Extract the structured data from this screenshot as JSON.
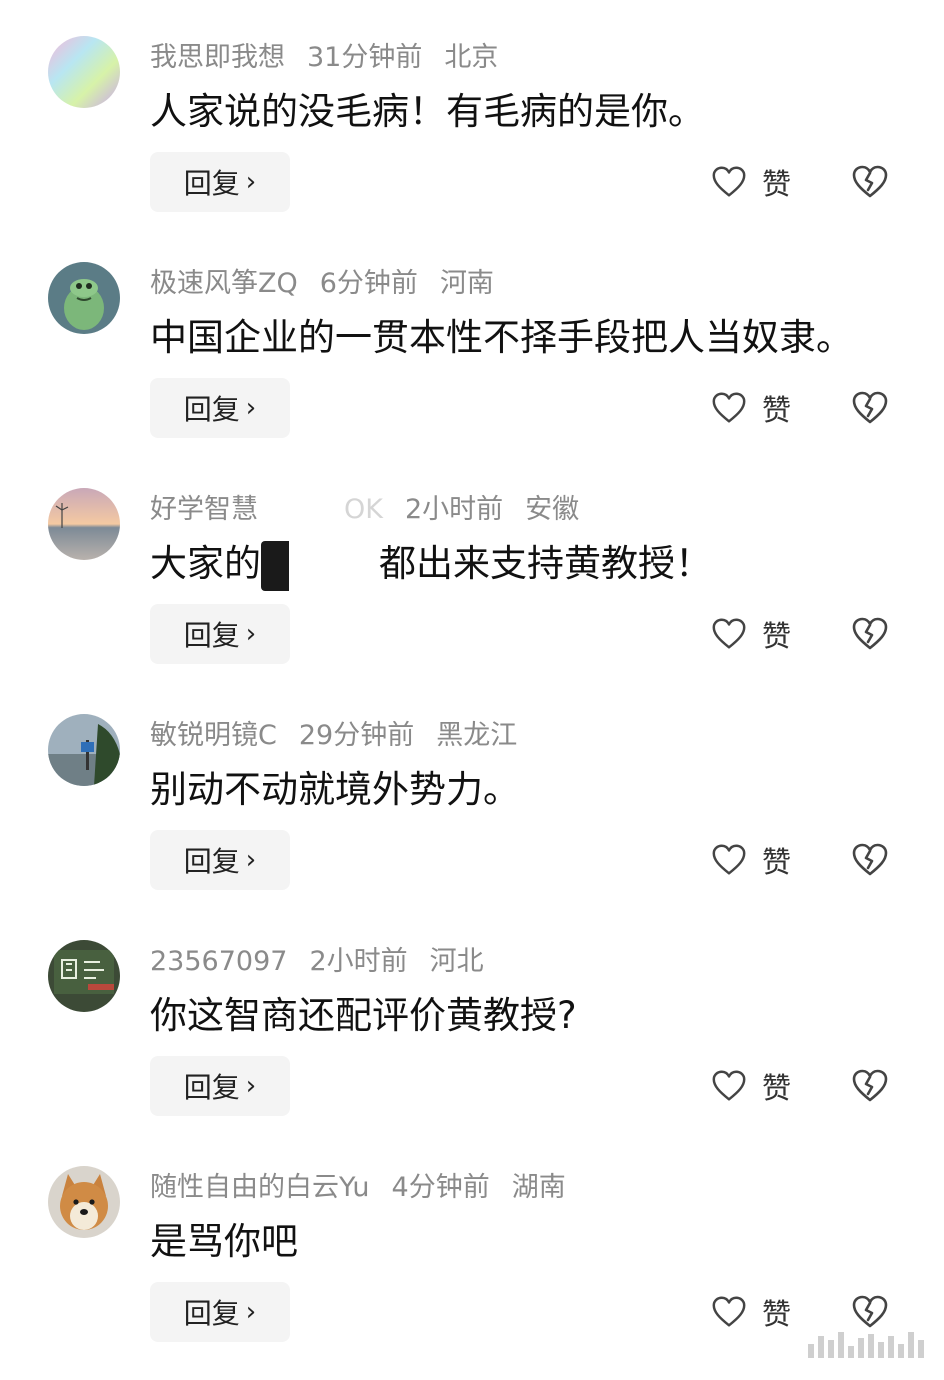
{
  "comments": [
    {
      "username": "我思即我想",
      "time": "31分钟前",
      "location": "北京",
      "text": "人家说的没毛病！有毛病的是你。",
      "reply_label": "回复",
      "like_label": "赞",
      "avatar": "gradient-avatar"
    },
    {
      "username": "极速风筝ZQ",
      "time": "6分钟前",
      "location": "河南",
      "text": "中国企业的一贯本性不择手段把人当奴隶。",
      "reply_label": "回复",
      "like_label": "赞",
      "avatar": "green-monster-avatar"
    },
    {
      "username_prefix": "好学智慧",
      "username_suffix": "OK",
      "time": "2小时前",
      "location": "安徽",
      "text_prefix": "大家的",
      "text_suffix": "都出来支持黄教授！",
      "reply_label": "回复",
      "like_label": "赞",
      "avatar": "sunset-lake-avatar"
    },
    {
      "username": "敏锐明镜C",
      "time": "29分钟前",
      "location": "黑龙江",
      "text": "别动不动就境外势力。",
      "reply_label": "回复",
      "like_label": "赞",
      "avatar": "roadside-sign-avatar"
    },
    {
      "username": "23567097",
      "time": "2小时前",
      "location": "河北",
      "text": "你这智商还配评价黄教授?",
      "reply_label": "回复",
      "like_label": "赞",
      "avatar": "chalkboard-avatar"
    },
    {
      "username": "随性自由的白云Yu",
      "time": "4分钟前",
      "location": "湖南",
      "text": "是骂你吧",
      "reply_label": "回复",
      "like_label": "赞",
      "avatar": "shiba-dog-avatar"
    }
  ],
  "icons": {
    "reply_chevron": "chevron-right-icon",
    "like": "heart-outline-icon",
    "dislike": "broken-heart-icon"
  },
  "colors": {
    "meta_text": "#8a8a8a",
    "main_text": "#111111",
    "reply_bg": "#f4f4f4"
  }
}
